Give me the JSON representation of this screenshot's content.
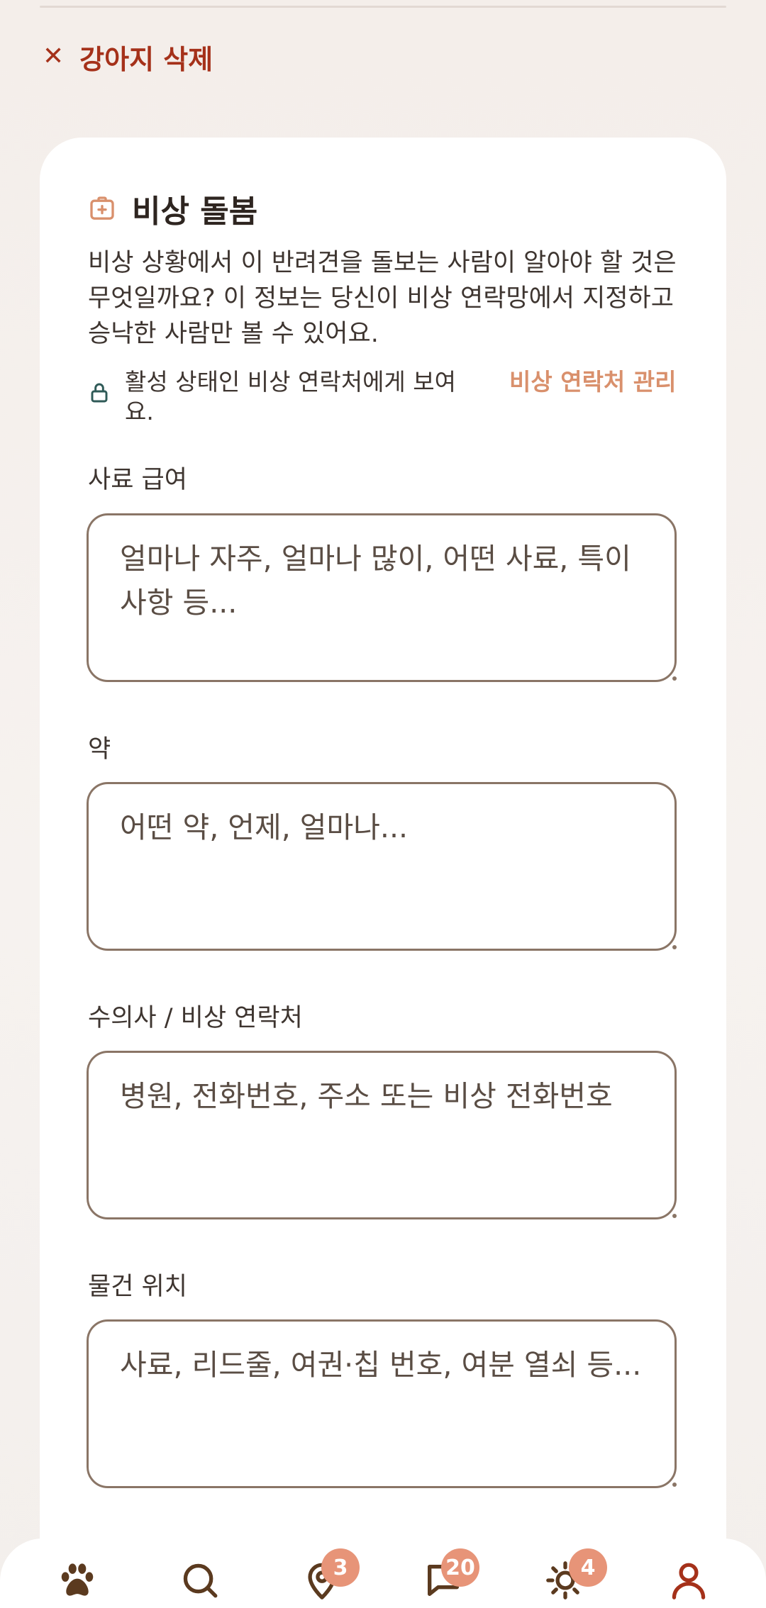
{
  "header": {
    "delete_icon": "close-icon",
    "delete_label": "강아지 삭제"
  },
  "card": {
    "title": "비상 돌봄",
    "title_icon": "medical-kit-icon",
    "description": "비상 상황에서 이 반려견을 돌보는 사람이 알아야 할 것은 무엇일까요? 이 정보는 당신이 비상 연락망에서 지정하고 승낙한 사람만 볼 수 있어요.",
    "visibility_icon": "lock-icon",
    "visibility_text": "활성 상태인 비상 연락처에게 보여요.",
    "manage_link": "비상 연락처 관리"
  },
  "fields": [
    {
      "label": "사료 급여",
      "placeholder": "얼마나 자주, 얼마나 많이, 어떤 사료, 특이사항 등..."
    },
    {
      "label": "약",
      "placeholder": "어떤 약, 언제, 얼마나..."
    },
    {
      "label": "수의사 / 비상 연락처",
      "placeholder": "병원, 전화번호, 주소 또는 비상 전화번호"
    },
    {
      "label": "물건 위치",
      "placeholder": "사료, 리드줄, 여권·칩 번호, 여분 열쇠 등..."
    }
  ],
  "nav": [
    {
      "icon": "paw-icon"
    },
    {
      "icon": "search-icon"
    },
    {
      "icon": "map-pin-icon",
      "badge": "3"
    },
    {
      "icon": "chat-icon",
      "badge": "20"
    },
    {
      "icon": "sun-icon",
      "badge": "4"
    },
    {
      "icon": "profile-icon"
    }
  ],
  "colors": {
    "accent": "#a5311a",
    "link": "#d9906c",
    "badge": "#e79478",
    "border": "#8a7566"
  }
}
